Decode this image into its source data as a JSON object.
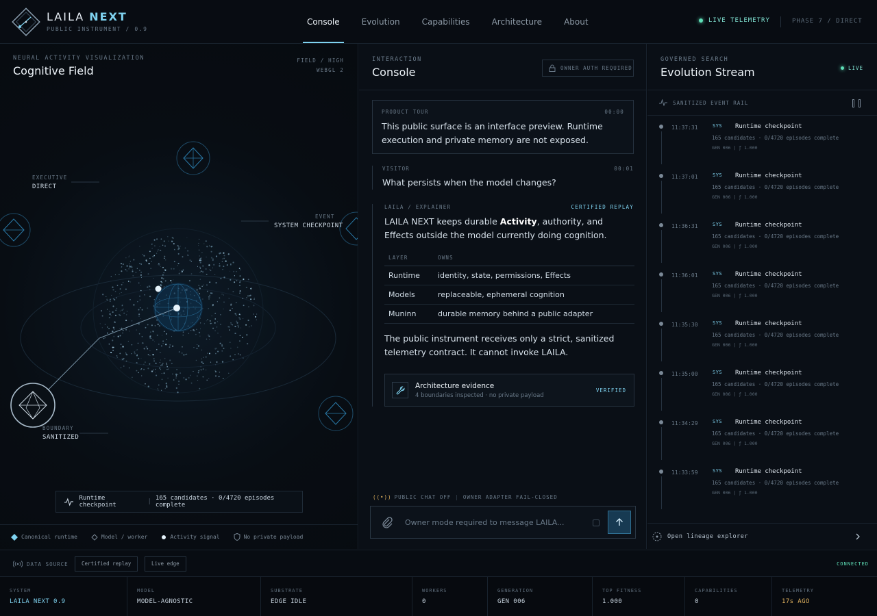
{
  "header": {
    "brand_primary": "LAILA",
    "brand_accent": "NEXT",
    "brand_sub": "PUBLIC INSTRUMENT / 0.9",
    "nav": [
      "Console",
      "Evolution",
      "Capabilities",
      "Architecture",
      "About"
    ],
    "active_nav": "Console",
    "telemetry": "LIVE TELEMETRY",
    "phase": "PHASE 7 / DIRECT"
  },
  "field": {
    "kicker": "NEURAL ACTIVITY VISUALIZATION",
    "title": "Cognitive Field",
    "mode_line1": "FIELD / HIGH",
    "mode_line2": "WEBGL 2",
    "labels": {
      "executive_kicker": "EXECUTIVE",
      "executive_value": "DIRECT",
      "event_kicker": "EVENT",
      "event_value": "SYSTEM CHECKPOINT",
      "boundary_kicker": "BOUNDARY",
      "boundary_value": "SANITIZED"
    },
    "caption_event": "Runtime checkpoint",
    "caption_detail": "165 candidates · 0/4720 episodes complete",
    "legend": [
      "Canonical runtime",
      "Model / worker",
      "Activity signal",
      "No private payload"
    ]
  },
  "console": {
    "kicker": "INTERACTION",
    "title": "Console",
    "auth_badge": "OWNER AUTH REQUIRED",
    "tour": {
      "label": "PRODUCT TOUR",
      "time": "00:00",
      "text": "This public surface is an interface preview. Runtime execution and private memory are not exposed."
    },
    "visitor": {
      "label": "VISITOR",
      "time": "00:01",
      "text": "What persists when the model changes?"
    },
    "reply": {
      "label": "LAILA / EXPLAINER",
      "badge": "CERTIFIED REPLAY",
      "text_before": "LAILA NEXT keeps durable ",
      "text_bold": "Activity",
      "text_after": ", authority, and Effects outside the model currently doing cognition.",
      "table_headers": [
        "LAYER",
        "OWNS"
      ],
      "table_rows": [
        [
          "Runtime",
          "identity, state, permissions, Effects"
        ],
        [
          "Models",
          "replaceable, ephemeral cognition"
        ],
        [
          "Muninn",
          "durable memory behind a public adapter"
        ]
      ],
      "text_second": "The public instrument receives only a strict, sanitized telemetry contract. It cannot invoke LAILA."
    },
    "evidence": {
      "title": "Architecture evidence",
      "subtitle": "4 boundaries inspected · no private payload",
      "status": "VERIFIED"
    },
    "chat_status_a": "PUBLIC CHAT OFF",
    "chat_status_b": "OWNER ADAPTER FAIL-CLOSED",
    "composer_placeholder": "Owner mode required to message LAILA..."
  },
  "stream": {
    "kicker": "GOVERNED SEARCH",
    "title": "Evolution Stream",
    "live": "LIVE",
    "rail": "SANITIZED EVENT RAIL",
    "events": [
      {
        "time": "11:37:31",
        "tag": "SYS",
        "title": "Runtime checkpoint",
        "detail": "165 candidates · 0/4720 episodes complete",
        "gen": "GEN 006  |  ƒ 1.000"
      },
      {
        "time": "11:37:01",
        "tag": "SYS",
        "title": "Runtime checkpoint",
        "detail": "165 candidates · 0/4720 episodes complete",
        "gen": "GEN 006  |  ƒ 1.000"
      },
      {
        "time": "11:36:31",
        "tag": "SYS",
        "title": "Runtime checkpoint",
        "detail": "165 candidates · 0/4720 episodes complete",
        "gen": "GEN 006  |  ƒ 1.000"
      },
      {
        "time": "11:36:01",
        "tag": "SYS",
        "title": "Runtime checkpoint",
        "detail": "165 candidates · 0/4720 episodes complete",
        "gen": "GEN 006  |  ƒ 1.000"
      },
      {
        "time": "11:35:30",
        "tag": "SYS",
        "title": "Runtime checkpoint",
        "detail": "165 candidates · 0/4720 episodes complete",
        "gen": "GEN 006  |  ƒ 1.000"
      },
      {
        "time": "11:35:00",
        "tag": "SYS",
        "title": "Runtime checkpoint",
        "detail": "165 candidates · 0/4720 episodes complete",
        "gen": "GEN 006  |  ƒ 1.000"
      },
      {
        "time": "11:34:29",
        "tag": "SYS",
        "title": "Runtime checkpoint",
        "detail": "165 candidates · 0/4720 episodes complete",
        "gen": "GEN 006  |  ƒ 1.000"
      },
      {
        "time": "11:33:59",
        "tag": "SYS",
        "title": "Runtime checkpoint",
        "detail": "165 candidates · 0/4720 episodes complete",
        "gen": "GEN 006  |  ƒ 1.000"
      }
    ],
    "lineage": "Open lineage explorer"
  },
  "source": {
    "label": "DATA SOURCE",
    "buttons": [
      "Certified replay",
      "Live edge"
    ],
    "status": "CONNECTED"
  },
  "status_bar": [
    {
      "label": "SYSTEM",
      "value": "LAILA NEXT 0.9"
    },
    {
      "label": "MODEL",
      "value": "MODEL-AGNOSTIC"
    },
    {
      "label": "SUBSTRATE",
      "value": "EDGE IDLE"
    },
    {
      "label": "WORKERS",
      "value": "0"
    },
    {
      "label": "GENERATION",
      "value": "GEN 006"
    },
    {
      "label": "TOP FITNESS",
      "value": "1.000"
    },
    {
      "label": "CAPABILITIES",
      "value": "0"
    },
    {
      "label": "TELEMETRY",
      "value": "17s AGO"
    }
  ],
  "colors": {
    "accent": "#7fd3f0",
    "live": "#5fe0b8",
    "warn": "#e0b25f",
    "background": "#070b10"
  }
}
